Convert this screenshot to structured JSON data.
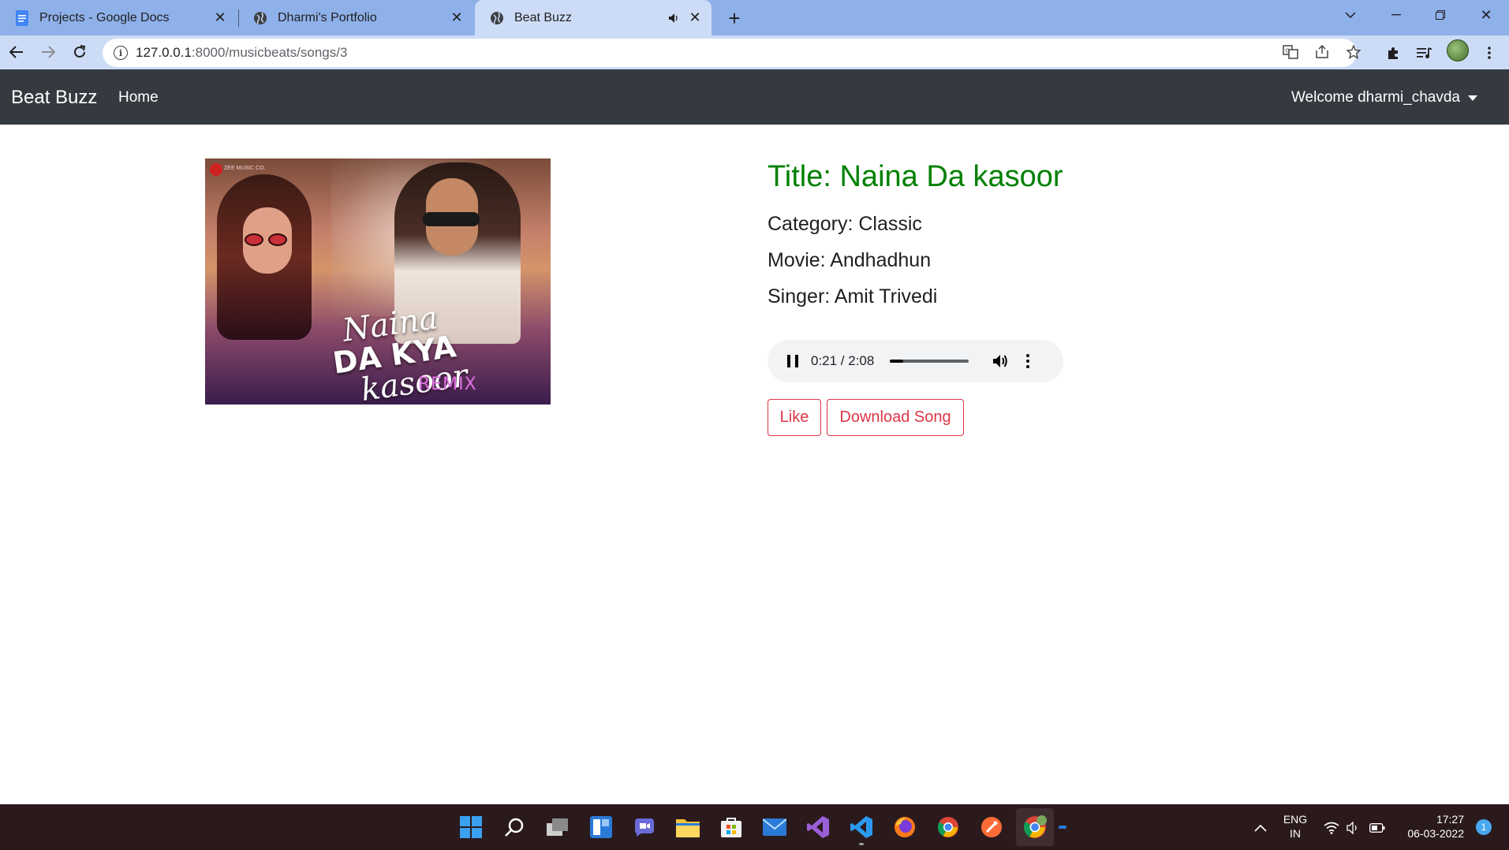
{
  "browser": {
    "tabs": [
      {
        "title": "Projects - Google Docs",
        "icon": "google-docs-icon"
      },
      {
        "title": "Dharmi's Portfolio",
        "icon": "globe-icon"
      },
      {
        "title": "Beat Buzz",
        "icon": "globe-icon",
        "active": true,
        "audio": "mute-tab-icon"
      }
    ],
    "url_host": "127.0.0.1",
    "url_rest": ":8000/musicbeats/songs/3"
  },
  "navbar": {
    "brand": "Beat Buzz",
    "home_label": "Home",
    "welcome": "Welcome dharmi_chavda"
  },
  "song": {
    "title": "Title: Naina Da kasoor",
    "category": "Category: Classic",
    "movie": "Movie: Andhadhun",
    "singer": "Singer: Amit Trivedi",
    "cover_art": {
      "line1": "Naina",
      "line2": "DA KYA",
      "line3": "kasoor",
      "remix": "REMIX",
      "label": "ZEE MUSIC CO."
    }
  },
  "player": {
    "time": "0:21 / 2:08",
    "progress_fraction": 0.164
  },
  "buttons": {
    "like": "Like",
    "download": "Download Song"
  },
  "taskbar": {
    "lang_line1": "ENG",
    "lang_line2": "IN",
    "time": "17:27",
    "date": "06-03-2022",
    "notifications": "1"
  },
  "colors": {
    "title_green": "#008000",
    "danger_red": "#dc3545",
    "navbar_dark": "#343a40"
  }
}
